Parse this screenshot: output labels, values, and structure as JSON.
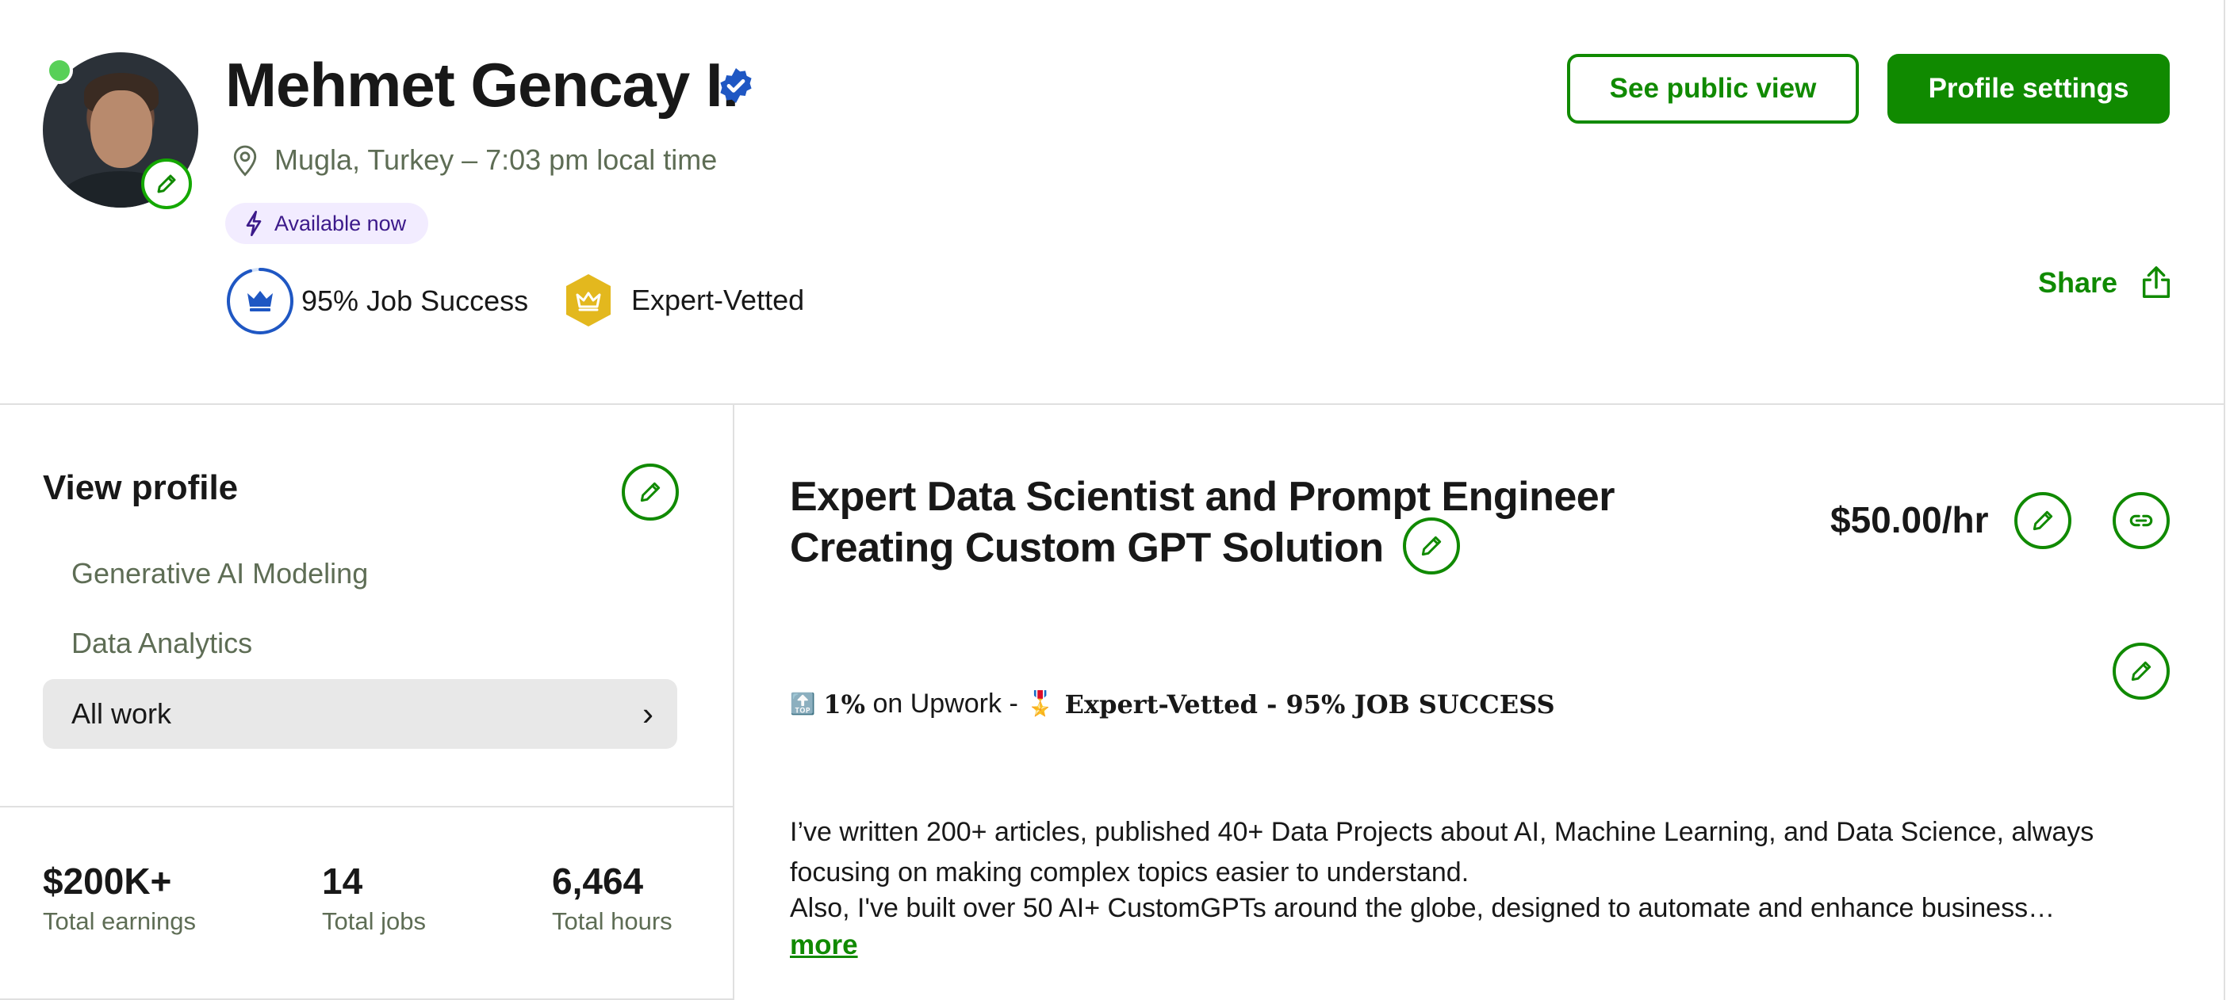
{
  "profile": {
    "name": "Mehmet Gencay I.",
    "location": "Mugla, Turkey – 7:03 pm local time",
    "availability": "Available now",
    "job_success": "95% Job Success",
    "job_success_percent": 95,
    "expert_badge": "Expert-Vetted"
  },
  "actions": {
    "see_public_view": "See public view",
    "profile_settings": "Profile settings",
    "share": "Share"
  },
  "sidebar": {
    "title": "View profile",
    "items": [
      {
        "label": "Generative AI Modeling"
      },
      {
        "label": "Data Analytics"
      },
      {
        "label": "All work",
        "chevron": "›"
      }
    ],
    "stats": [
      {
        "value": "$200K+",
        "label": "Total earnings"
      },
      {
        "value": "14",
        "label": "Total jobs"
      },
      {
        "value": "6,464",
        "label": "Total hours"
      }
    ]
  },
  "main": {
    "headline": "Expert Data Scientist and Prompt Engineer Creating Custom GPT Solution",
    "rate": "$50.00/hr",
    "tagline": {
      "top_icon": "🔝",
      "percent": "1%",
      "on": " on Upwork - ",
      "medal_icon": "🎖️",
      "expert": "Expert-Vetted - 95% JOB SUCCESS"
    },
    "paragraph1": "I’ve written 200+ articles, published 40+ Data Projects about AI, Machine Learning, and Data Science, always focusing on making complex topics easier to understand.",
    "paragraph2": "Also, I've built over 50 AI+ CustomGPTs around the globe, designed to automate and enhance business…",
    "more": "more"
  },
  "colors": {
    "brand_green": "#108a00",
    "verified_blue": "#1f57c3",
    "available_bg": "#f2ecff",
    "online_dot": "#58d058",
    "expert_gold": "#e3b81e"
  },
  "icons": [
    "verified-badge-icon",
    "location-pin-icon",
    "lightning-icon",
    "crown-icon",
    "expert-crown-icon",
    "share-icon",
    "pencil-icon",
    "link-icon",
    "chevron-right-icon"
  ]
}
